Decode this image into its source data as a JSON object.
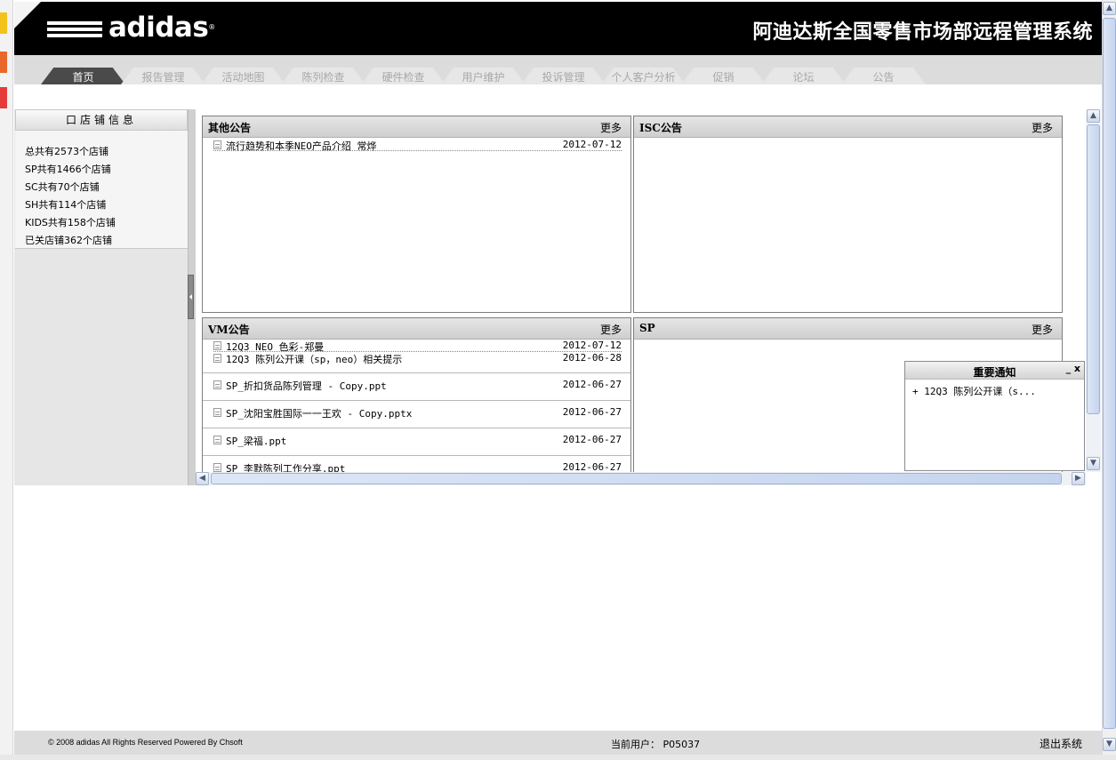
{
  "header": {
    "logo_text": "adidas",
    "system_title": "阿迪达斯全国零售市场部远程管理系统"
  },
  "nav": {
    "tabs": [
      {
        "label": "首页",
        "active": true
      },
      {
        "label": "报告管理"
      },
      {
        "label": "活动地图"
      },
      {
        "label": "陈列检查"
      },
      {
        "label": "硬件检查"
      },
      {
        "label": "用户维护"
      },
      {
        "label": "投诉管理"
      },
      {
        "label": "个人客户分析"
      },
      {
        "label": "促销"
      },
      {
        "label": "论坛"
      },
      {
        "label": "公告"
      }
    ]
  },
  "store_info": {
    "title": "口店铺信息",
    "items": [
      "总共有2573个店铺",
      "SP共有1466个店铺",
      "SC共有70个店铺",
      "SH共有114个店铺",
      "KIDS共有158个店铺",
      "已关店铺362个店铺"
    ]
  },
  "panels": {
    "other": {
      "title": "其他公告",
      "more": "更多",
      "rows": [
        {
          "text": "流行趋势和本季NEO产品介绍 常烨",
          "date": "2012-07-12"
        }
      ]
    },
    "isc": {
      "title": "ISC公告",
      "more": "更多"
    },
    "vm": {
      "title": "VM公告",
      "more": "更多",
      "rows": [
        {
          "text": "12Q3 NEO 色彩-郑曼",
          "date": "2012-07-12"
        },
        {
          "text": "12Q3 陈列公开课（sp，neo）相关提示",
          "date": "2012-06-28"
        },
        {
          "text": "SP_折扣货品陈列管理 - Copy.ppt",
          "date": "2012-06-27"
        },
        {
          "text": "SP_沈阳宝胜国际一一王欢 - Copy.pptx",
          "date": "2012-06-27"
        },
        {
          "text": "SP_梁福.ppt",
          "date": "2012-06-27"
        },
        {
          "text": "SP_李默陈列工作分享.ppt",
          "date": "2012-06-27"
        }
      ]
    },
    "sp": {
      "title": "SP",
      "more": "更多"
    }
  },
  "notice": {
    "title": "重要通知",
    "buttons": "_ x",
    "item": "+ 12Q3 陈列公开课（s..."
  },
  "footer": {
    "copyright": "© 2008 adidas All Rights Reserved Powered By Chsoft",
    "current_user": "当前用户： P05037",
    "logout": "退出系统"
  }
}
